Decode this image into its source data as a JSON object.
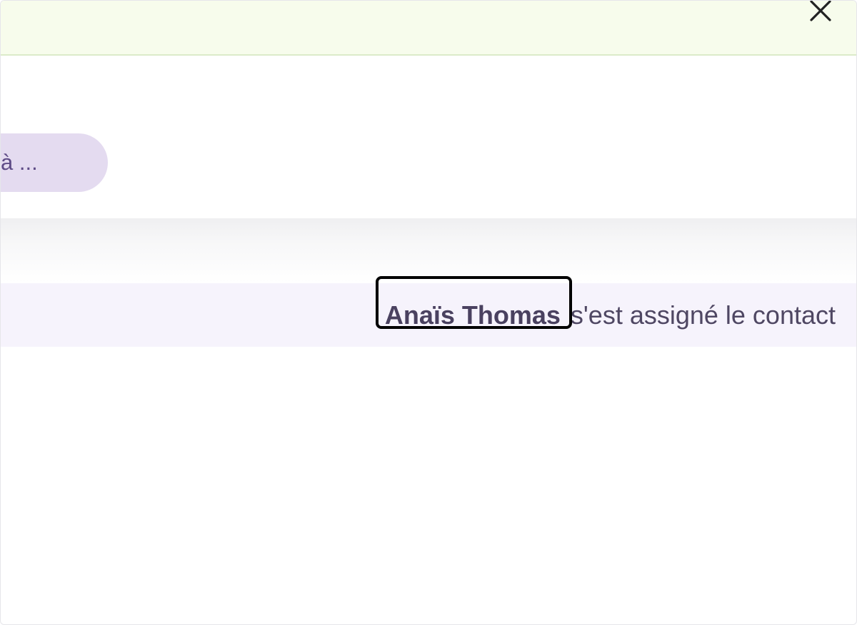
{
  "banner": {
    "close_icon": "close-icon"
  },
  "panel": {
    "pill_label": "à ..."
  },
  "activity": {
    "actor_name": "Anaïs Thomas",
    "action_text": "s'est assigné le contact"
  },
  "colors": {
    "banner_bg": "#f7fcec",
    "pill_bg": "#e4dbf0",
    "row_bg": "#f6f3fc",
    "text": "#4f4763"
  }
}
